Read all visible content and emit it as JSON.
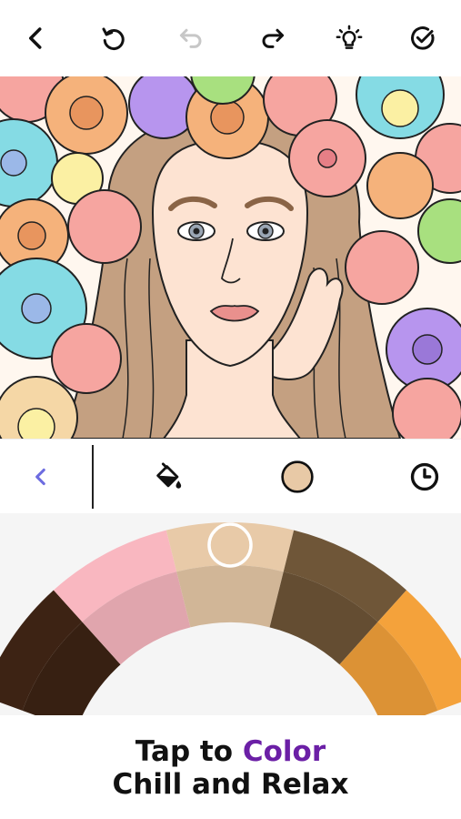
{
  "toolbar": {
    "back_icon": "chevron-left-icon",
    "undo_icon": "rotate-ccw-icon",
    "undo_disabled_icon": "undo-arrow-icon",
    "redo_icon": "redo-arrow-icon",
    "hint_icon": "lightbulb-icon",
    "done_icon": "check-circle-icon"
  },
  "tools": {
    "collapse_icon": "chevron-left-icon",
    "fill_icon": "paint-bucket-icon",
    "selected_color": "#E8C9A6",
    "history_icon": "clock-icon"
  },
  "palette": {
    "colors": [
      "#3D2314",
      "#F9B7C0",
      "#E8CAA8",
      "#6F5638",
      "#F4A23B"
    ],
    "selected_color": "#E8CAA8"
  },
  "footer": {
    "line1_prefix": "Tap to ",
    "line1_highlight": "Color",
    "line2": "Chill and Relax",
    "highlight_color": "#6B1FA6"
  }
}
